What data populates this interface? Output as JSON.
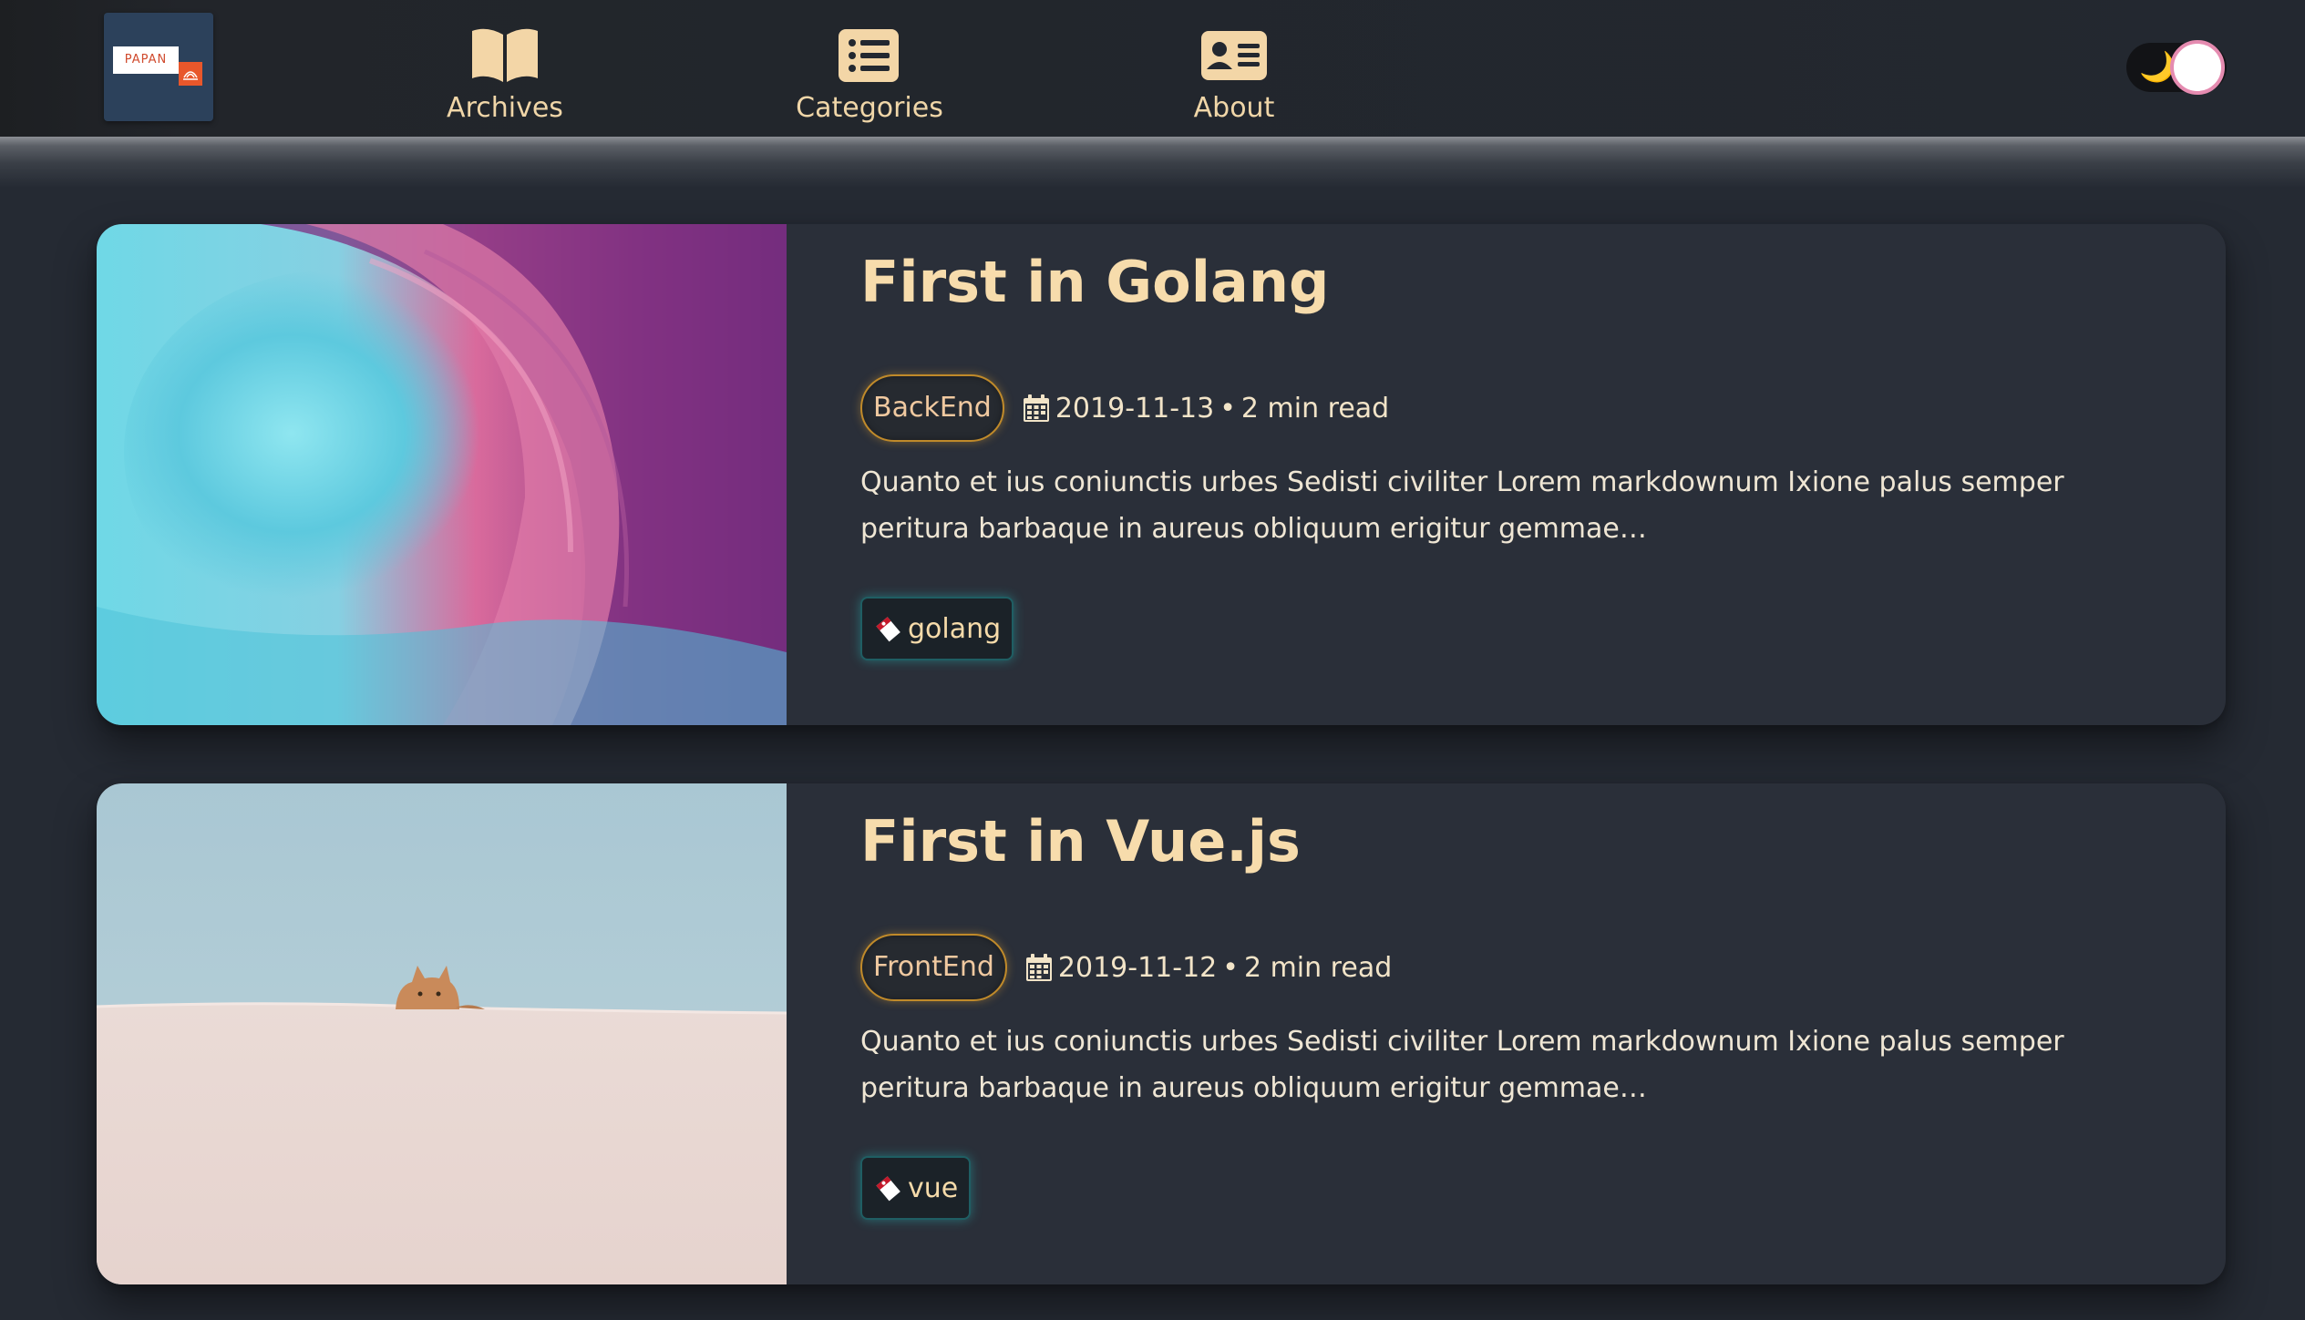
{
  "header": {
    "logo_text": "PAPAN",
    "nav": [
      {
        "label": "Archives",
        "icon": "book-open-icon"
      },
      {
        "label": "Categories",
        "icon": "list-icon"
      },
      {
        "label": "About",
        "icon": "id-card-icon"
      }
    ],
    "theme_toggle": {
      "icon": "moon-icon",
      "glyph": "🌙",
      "state": "dark"
    }
  },
  "posts": [
    {
      "title": "First in Golang",
      "category": "BackEnd",
      "date": "2019-11-13",
      "separator": "•",
      "read_time": "2 min read",
      "excerpt": "Quanto et ius coniunctis urbes Sedisti civiliter Lorem markdownum Ixione palus semper peritura barbaque in aureus obliquum erigitur gemmae…",
      "tag": "golang",
      "image": "wave-image"
    },
    {
      "title": "First in Vue.js",
      "category": "FrontEnd",
      "date": "2019-11-12",
      "separator": "•",
      "read_time": "2 min read",
      "excerpt": "Quanto et ius coniunctis urbes Sedisti civiliter Lorem markdownum Ixione palus semper peritura barbaque in aureus obliquum erigitur gemmae…",
      "tag": "vue",
      "image": "cat-on-wall-image"
    }
  ],
  "colors": {
    "background": "#252a33",
    "card": "#2a2f39",
    "title": "#f7dcac",
    "category_border": "#c08a2a",
    "tag_glow": "#28bebe"
  }
}
